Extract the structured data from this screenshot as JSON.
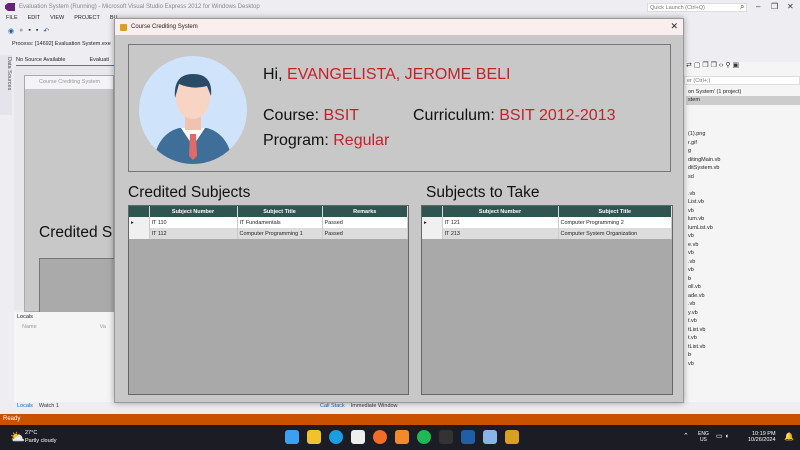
{
  "vs": {
    "title": "Evaluation System (Running) - Microsoft Visual Studio Express 2012 for Windows Desktop",
    "quick_launch": "Quick Launch (Ctrl+Q)",
    "menu": [
      "FILE",
      "EDIT",
      "VIEW",
      "PROJECT",
      "BU"
    ],
    "process": "Process:  [14692] Evaluation System.exe",
    "data_sources": "Data Sources",
    "doc_tabs": [
      "No Source Available",
      "Evaluati"
    ],
    "ghost_title": "Course Crediting System",
    "ghost_heading": "Credited S",
    "locals": {
      "title": "Locals",
      "col": "Name",
      "col2": "Va"
    },
    "bottom_tabs": [
      "Locals",
      "Watch 1"
    ],
    "bottom_tabs2": [
      "Call Stack",
      "Immediate Window"
    ],
    "status": "Ready",
    "solution": {
      "search": "er (Ctrl+;)",
      "items": [
        "on System' (1 project)",
        "stem",
        "",
        "",
        "",
        "(1).png",
        "r.gif",
        "g",
        "ditingMain.vb",
        "ditSystem.vb",
        "sd",
        "",
        ".vb",
        "List.vb",
        "vb",
        "lum.vb",
        "lumList.vb",
        "vb",
        "e.vb",
        "vb",
        ".vb",
        "vb",
        "b",
        "oll.vb",
        "ade.vb",
        ".vb",
        "y.vb",
        "t.vb",
        "tList.vb",
        "t.vb",
        "tList.vb",
        "b",
        "vb"
      ]
    }
  },
  "dialog": {
    "title": "Course Crediting System",
    "greeting": "Hi,",
    "name": "EVANGELISTA, JEROME BELI",
    "course_label": "Course:",
    "course": "BSIT",
    "curriculum_label": "Curriculum:",
    "curriculum": "BSIT 2012-2013",
    "program_label": "Program:",
    "program": "Regular",
    "credited": {
      "heading": "Credited Subjects",
      "columns": [
        "Subject Number",
        "Subject Title",
        "Remarks"
      ],
      "rows": [
        [
          "IT 110",
          "IT Fundamentals",
          "Passed"
        ],
        [
          "IT 112",
          "Computer Programming 1",
          "Passed"
        ]
      ]
    },
    "to_take": {
      "heading": "Subjects to Take",
      "columns": [
        "Subject Number",
        "Subject Title"
      ],
      "rows": [
        [
          "IT 121",
          "Computer Programming 2"
        ],
        [
          "IT 213",
          "Computer System Organization"
        ]
      ]
    }
  },
  "taskbar": {
    "temp": "27°C",
    "weather": "Partly cloudy",
    "lang1": "ENG",
    "lang2": "US",
    "time": "10:19 PM",
    "date": "10/26/2024"
  }
}
